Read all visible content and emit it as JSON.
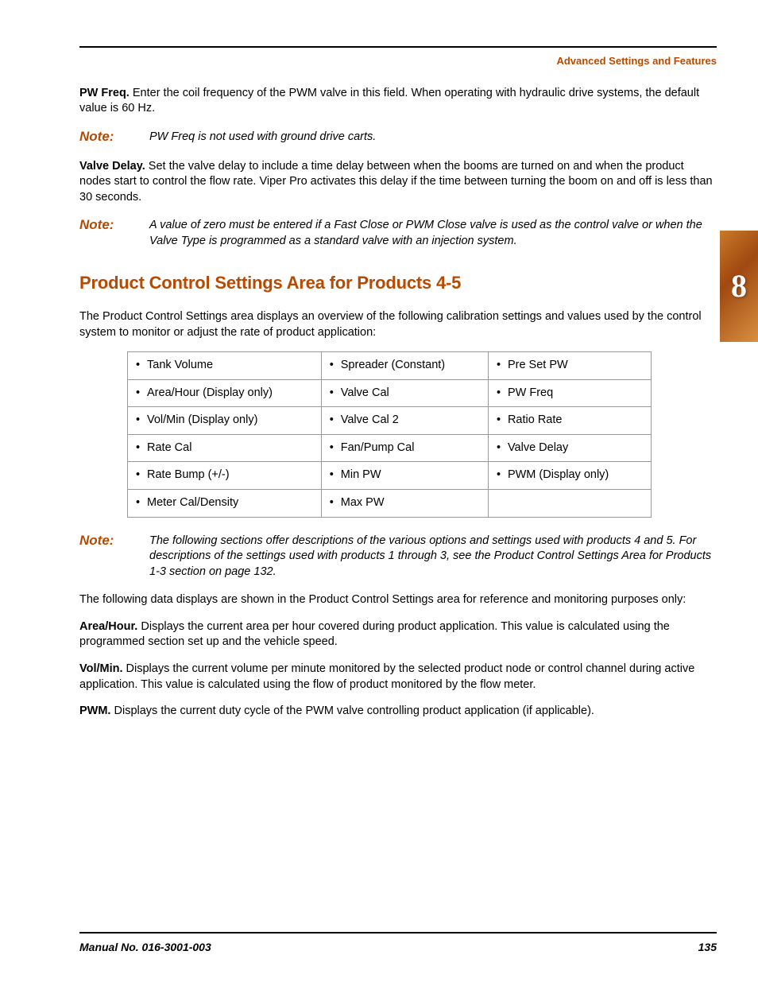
{
  "header": {
    "title": "Advanced Settings and Features"
  },
  "tab": {
    "number": "8"
  },
  "p1": {
    "label": "PW Freq.",
    "text": " Enter the coil frequency of the PWM valve in this field. When operating with hydraulic drive systems, the default value is 60 Hz."
  },
  "note1": {
    "label": "Note:",
    "text": "PW Freq is not used with ground drive carts."
  },
  "p2": {
    "label": "Valve Delay.",
    "text": " Set the valve delay to include a time delay between when the booms are turned on and when the product nodes start to control the flow rate. Viper Pro activates this delay if the time between turning the boom on and off is less than 30 seconds."
  },
  "note2": {
    "label": "Note:",
    "text": "A value of zero must be entered if a Fast Close or PWM Close valve is used as the control valve or when the Valve Type is programmed as a standard valve with an injection system."
  },
  "section": {
    "title": "Product Control Settings Area for Products 4-5"
  },
  "p3": "The Product Control Settings area displays an overview of the following calibration settings and values used by the control system to monitor or adjust the rate of product application:",
  "table": {
    "r0c0": "Tank Volume",
    "r0c1": "Spreader (Constant)",
    "r0c2": "Pre Set PW",
    "r1c0": "Area/Hour (Display only)",
    "r1c1": "Valve Cal",
    "r1c2": "PW Freq",
    "r2c0": "Vol/Min (Display only)",
    "r2c1": "Valve Cal 2",
    "r2c2": "Ratio Rate",
    "r3c0": "Rate Cal",
    "r3c1": "Fan/Pump Cal",
    "r3c2": "Valve Delay",
    "r4c0": "Rate Bump (+/-)",
    "r4c1": "Min PW",
    "r4c2": "PWM (Display only)",
    "r5c0": "Meter Cal/Density",
    "r5c1": "Max PW",
    "r5c2": ""
  },
  "note3": {
    "label": "Note:",
    "text": "The following sections offer descriptions of the various options and settings used with products 4 and 5. For descriptions of the settings used with products 1 through 3, see the Product Control Settings Area for Products 1-3 section on page 132."
  },
  "p4": "The following data displays are shown in the Product Control Settings area for reference and monitoring purposes only:",
  "p5": {
    "label": "Area/Hour.",
    "text": " Displays the current area per hour covered during product application. This value is calculated using the programmed section set up and the vehicle speed."
  },
  "p6": {
    "label": "Vol/Min.",
    "text": " Displays the current volume per minute monitored by the selected product node or control channel during active application. This value is calculated using the flow of product monitored by the flow meter."
  },
  "p7": {
    "label": "PWM.",
    "text": " Displays the current duty cycle of the PWM valve controlling product application (if applicable)."
  },
  "footer": {
    "left": "Manual No. 016-3001-003",
    "right": "135"
  }
}
